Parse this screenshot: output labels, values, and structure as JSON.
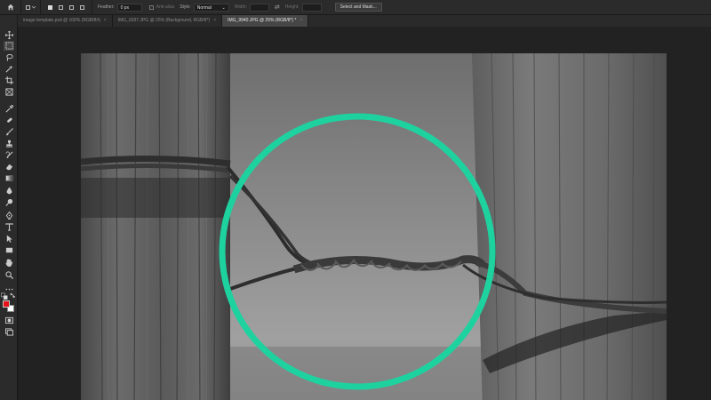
{
  "options_bar": {
    "feather_label": "Feather:",
    "feather_value": "0 px",
    "antialias_label": "Anti-alias",
    "style_label": "Style:",
    "style_value": "Normal",
    "width_label": "Width:",
    "height_label": "Height:",
    "select_mask_label": "Select and Mask..."
  },
  "tabs": [
    {
      "label": "image template.psd @ 100% (RGB/8#)",
      "close": "×"
    },
    {
      "label": "IMG_6037.JPG @ 25% (Background, RGB/8*)",
      "close": "×"
    },
    {
      "label": "IMG_9940.JPG @ 25% (RGB/8*) *",
      "close": "×"
    }
  ],
  "active_tab": 2,
  "colors": {
    "foreground": "#e3121a",
    "background": "#ffffff",
    "highlight_circle": "#1ed2a0"
  },
  "tools": [
    "move-tool",
    "marquee-tool",
    "lasso-tool",
    "quick-select-tool",
    "crop-tool",
    "frame-tool",
    "eyedropper-tool",
    "healing-brush-tool",
    "brush-tool",
    "clone-stamp-tool",
    "history-brush-tool",
    "eraser-tool",
    "gradient-tool",
    "blur-tool",
    "dodge-tool",
    "pen-tool",
    "type-tool",
    "path-select-tool",
    "rectangle-tool",
    "hand-tool",
    "zoom-tool",
    "more-tools",
    "default-colors",
    "swap-colors",
    "quick-mask",
    "screen-mode"
  ]
}
